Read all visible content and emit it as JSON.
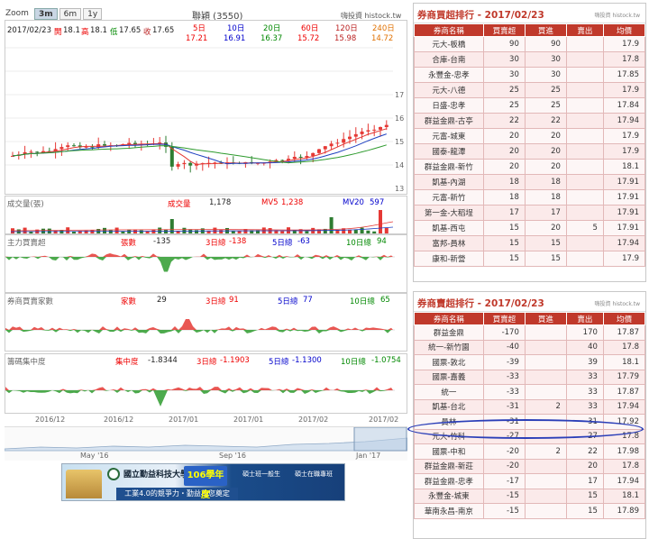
{
  "chart": {
    "zoom_label": "Zoom",
    "zoom_options": [
      "3m",
      "6m",
      "1y"
    ],
    "zoom_active": "3m",
    "stock_title": "聯穎 (3550)",
    "brand": "嗨投資 histock.tw",
    "ohlc": {
      "date": "2017/02/23",
      "open_label": "開",
      "open": "18.1",
      "high_label": "高",
      "high": "18.1",
      "low_label": "低",
      "low": "17.65",
      "close_label": "收",
      "close": "17.65"
    },
    "ma": [
      {
        "label": "5日",
        "value": "17.21",
        "color": "#e00000"
      },
      {
        "label": "10日",
        "value": "16.91",
        "color": "#0000cc"
      },
      {
        "label": "20日",
        "value": "16.37",
        "color": "#008800"
      },
      {
        "label": "60日",
        "value": "15.72",
        "color": "#e00000"
      },
      {
        "label": "120日",
        "value": "15.98",
        "color": "#b22222"
      },
      {
        "label": "240日",
        "value": "14.72",
        "color": "#e07000"
      }
    ],
    "y_ticks": [
      "17",
      "16",
      "15",
      "14",
      "13"
    ],
    "volume": {
      "title": "成交量(張)",
      "vol_label": "成交量",
      "vol_value": "1,178",
      "mv5_label": "MV5",
      "mv5_value": "1,238",
      "mv20_label": "MV20",
      "mv20_value": "597"
    },
    "indicators": [
      {
        "title": "主力買賣超",
        "k1": "張數",
        "v1": "-135",
        "k2": "3日總",
        "v2": "-138",
        "k3": "5日總",
        "v3": "-63",
        "k4": "10日總",
        "v4": "94"
      },
      {
        "title": "券商買賣家數",
        "k1": "家數",
        "v1": "29",
        "k2": "3日總",
        "v2": "91",
        "k3": "5日總",
        "v3": "77",
        "k4": "10日總",
        "v4": "65"
      },
      {
        "title": "籌碼集中度",
        "k1": "集中度",
        "v1": "-1.8344",
        "k2": "3日總",
        "v2": "-1.1903",
        "k3": "5日總",
        "v3": "-1.1300",
        "k4": "10日總",
        "v4": "-1.0754"
      }
    ],
    "x_labels": [
      "2016/12",
      "2016/12",
      "2017/01",
      "2017/01",
      "2017/02",
      "2017/02"
    ],
    "navigator_labels": [
      "May '16",
      "Sep '16",
      "Jan '17"
    ]
  },
  "ad": {
    "school": "國立勤益科技大學",
    "slogan": "工業4.0的競爭力・勤益為您奠定",
    "badge": "106學年度",
    "line1": "碩士班一般生",
    "line2": "碩士在職專班"
  },
  "rank_top": {
    "title": "券商買超排行 - 2017/02/23",
    "source": "嗨投資 histock.tw",
    "headers": [
      "券商名稱",
      "買賣超",
      "買進",
      "賣出",
      "均價"
    ],
    "rows": [
      [
        "元大-板橋",
        "90",
        "90",
        "",
        "17.9"
      ],
      [
        "合庫-台南",
        "30",
        "30",
        "",
        "17.8"
      ],
      [
        "永豐金-忠孝",
        "30",
        "30",
        "",
        "17.85"
      ],
      [
        "元大-八德",
        "25",
        "25",
        "",
        "17.9"
      ],
      [
        "日盛-忠孝",
        "25",
        "25",
        "",
        "17.84"
      ],
      [
        "群益金鼎-古亭",
        "22",
        "22",
        "",
        "17.94"
      ],
      [
        "元富-城東",
        "20",
        "20",
        "",
        "17.9"
      ],
      [
        "國泰-龍潭",
        "20",
        "20",
        "",
        "17.9"
      ],
      [
        "群益金鼎-新竹",
        "20",
        "20",
        "",
        "18.1"
      ],
      [
        "凱基-內湖",
        "18",
        "18",
        "",
        "17.91"
      ],
      [
        "元富-新竹",
        "18",
        "18",
        "",
        "17.91"
      ],
      [
        "第一金-大稻埕",
        "17",
        "17",
        "",
        "17.91"
      ],
      [
        "凱基-西屯",
        "15",
        "20",
        "5",
        "17.91"
      ],
      [
        "富邦-員林",
        "15",
        "15",
        "",
        "17.94"
      ],
      [
        "康和-新營",
        "15",
        "15",
        "",
        "17.9"
      ]
    ]
  },
  "rank_bottom": {
    "title": "券商賣超排行 - 2017/02/23",
    "source": "嗨投資 histock.tw",
    "headers": [
      "券商名稱",
      "買賣超",
      "買進",
      "賣出",
      "均價"
    ],
    "rows": [
      [
        "群益金鼎",
        "-170",
        "",
        "170",
        "17.87"
      ],
      [
        "統一-新竹園",
        "-40",
        "",
        "40",
        "17.8"
      ],
      [
        "國票-敦北",
        "-39",
        "",
        "39",
        "18.1"
      ],
      [
        "國票-嘉義",
        "-33",
        "",
        "33",
        "17.79"
      ],
      [
        "統一",
        "-33",
        "",
        "33",
        "17.87"
      ],
      [
        "凱基-台北",
        "-31",
        "2",
        "33",
        "17.94"
      ],
      [
        "員林",
        "-31",
        "",
        "31",
        "17.92"
      ],
      [
        "元大-竹科",
        "-27",
        "",
        "27",
        "17.8"
      ],
      [
        "國票-中和",
        "-20",
        "2",
        "22",
        "17.98"
      ],
      [
        "群益金鼎-新莊",
        "-20",
        "",
        "20",
        "17.8"
      ],
      [
        "群益金鼎-忠孝",
        "-17",
        "",
        "17",
        "17.94"
      ],
      [
        "永豐金-城東",
        "-15",
        "",
        "15",
        "18.1"
      ],
      [
        "華南永昌-南京",
        "-15",
        "",
        "15",
        "17.89"
      ]
    ]
  }
}
